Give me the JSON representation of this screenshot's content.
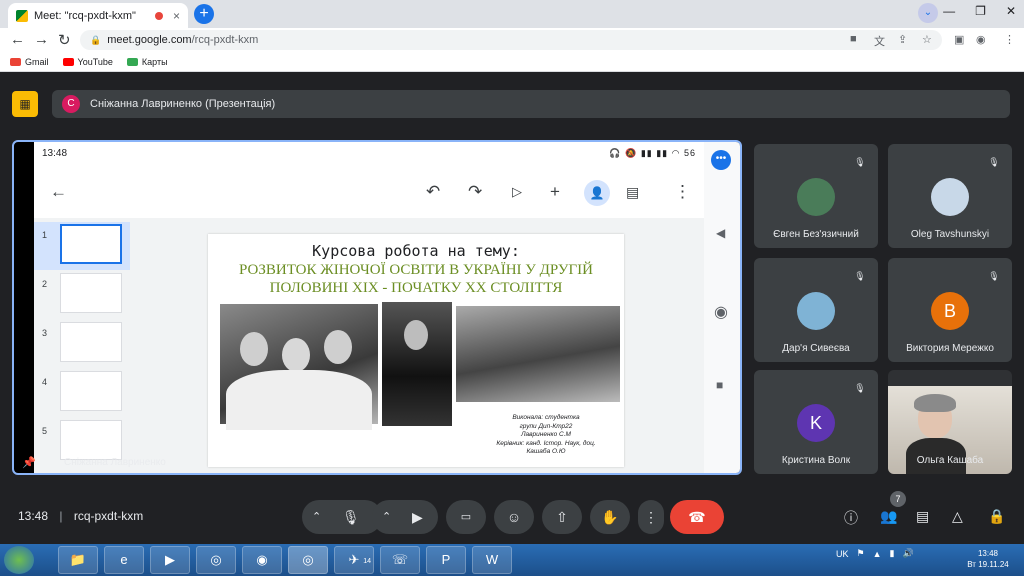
{
  "browser": {
    "tab_title": "Meet: \"rcq-pxdt-kxm\"",
    "tab_close": "×",
    "new_tab": "+",
    "url_domain": "meet.google.com",
    "url_path": "/rcq-pxdt-kxm",
    "bookmarks": [
      {
        "label": "Gmail",
        "color": "#ea4335"
      },
      {
        "label": "YouTube",
        "color": "#ff0000"
      },
      {
        "label": "Карты",
        "color": "#34a853"
      }
    ]
  },
  "meet": {
    "presenter_initial": "С",
    "presenter_label": "Сніжанна Лавриненко (Презентація)",
    "meeting_time": "13:48",
    "meeting_code": "rcq-pxdt-kxm",
    "people_count": "7"
  },
  "phone": {
    "status_time": "13:48",
    "battery": "56",
    "presenter_overlay": "Сніжанна Лавриненко"
  },
  "slides": {
    "thumbnails": [
      "1",
      "2",
      "3",
      "4",
      "5"
    ],
    "selected": "1"
  },
  "slide": {
    "title": "Курсова робота на тему:",
    "subtitle_line1": "РОЗВИТОК ЖІНОЧОЇ ОСВІТИ В УКРАЇНІ У ДРУГІЙ",
    "subtitle_line2": "ПОЛОВИНІ ХІХ - ПОЧАТКУ ХХ СТОЛІТТЯ",
    "credit_lines": [
      "Виконала: студентка",
      "групи Дип-Ктр22",
      "Лавриненко С.М",
      "Керівник: канд. Істор. Наук, доц.",
      "Кашаба О.Ю"
    ]
  },
  "participants": [
    {
      "name": "Євген Без'язичний",
      "type": "photo",
      "color": "#4a7c59",
      "initial": ""
    },
    {
      "name": "Oleg Tavshunskyi",
      "type": "photo",
      "color": "#c8d8e8",
      "initial": ""
    },
    {
      "name": "Дар'я Сивеєва",
      "type": "photo",
      "color": "#7fb3d5",
      "initial": ""
    },
    {
      "name": "Виктория Мережко",
      "type": "initial",
      "color": "#e8710a",
      "initial": "B"
    },
    {
      "name": "Кристина Волк",
      "type": "initial",
      "color": "#5e35b1",
      "initial": "K"
    },
    {
      "name": "Ольга Кашаба",
      "type": "video",
      "color": "#d7d2c8",
      "initial": ""
    }
  ],
  "taskbar": {
    "language": "UK",
    "time": "13:48",
    "date": "Вт 19.11.24",
    "telegram_badge": "14"
  }
}
